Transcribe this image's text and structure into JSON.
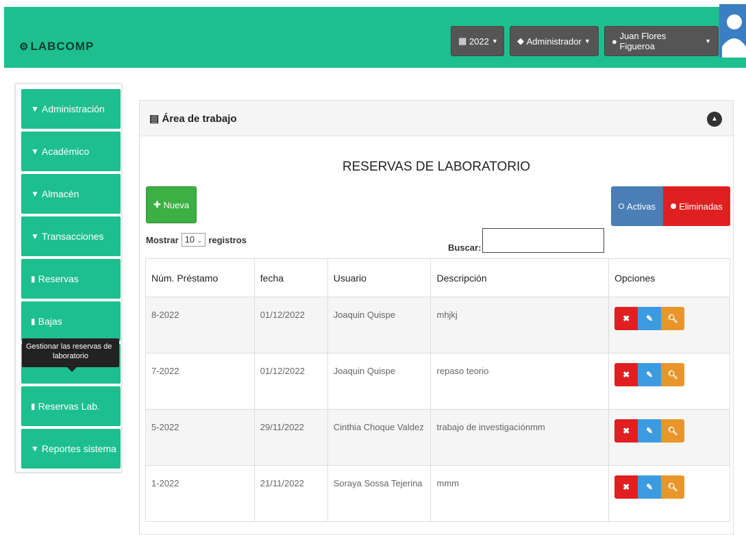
{
  "header": {
    "brand": "LABCOMP",
    "year_label": "2022",
    "role_label": "Administrador",
    "user_label": "Juan Flores Figueroa"
  },
  "sidebar": {
    "items": [
      {
        "label": "Administración",
        "icon": "chevron-down-icon"
      },
      {
        "label": "Académico",
        "icon": "chevron-down-icon"
      },
      {
        "label": "Almacén",
        "icon": "chevron-down-icon"
      },
      {
        "label": "Transacciones",
        "icon": "chevron-down-icon"
      },
      {
        "label": "Reservas",
        "icon": "file-icon"
      },
      {
        "label": "Bajas",
        "icon": "file-icon"
      },
      {
        "label": "Reservas Lab.",
        "icon": "file-icon"
      },
      {
        "label": "Reportes sistema",
        "icon": "chevron-down-icon"
      }
    ],
    "tooltip_line1": "Gestionar las reservas de",
    "tooltip_line2": "laboratorio"
  },
  "panel": {
    "title": "Área de trabajo",
    "heading": "RESERVAS DE LABORATORIO",
    "new_button": "Nueva",
    "active_button": "Activas",
    "deleted_button": "Eliminadas",
    "show_label": "Mostrar",
    "show_value": "10",
    "records_label": "registros",
    "search_label": "Buscar:"
  },
  "table": {
    "headers": [
      "Núm. Préstamo",
      "fecha",
      "Usuario",
      "Descripción",
      "Opciones"
    ],
    "rows": [
      {
        "num": "8-2022",
        "fecha": "01/12/2022",
        "usuario": "Joaquin Quispe",
        "descripcion": "mhjkj"
      },
      {
        "num": "7-2022",
        "fecha": "01/12/2022",
        "usuario": "Joaquin Quispe",
        "descripcion": "repaso teorio"
      },
      {
        "num": "5-2022",
        "fecha": "29/11/2022",
        "usuario": "Cinthia Choque Valdez",
        "descripcion": "trabajo de investigaciónmm"
      },
      {
        "num": "1-2022",
        "fecha": "21/11/2022",
        "usuario": "Soraya Sossa Tejerina",
        "descripcion": "mmm"
      }
    ]
  },
  "colors": {
    "brand_green": "#1dbf8f",
    "new_green": "#3cb043",
    "active_blue": "#4a7fb5",
    "delete_red": "#e02020",
    "edit_blue": "#3c9be0",
    "view_orange": "#e8962a"
  }
}
